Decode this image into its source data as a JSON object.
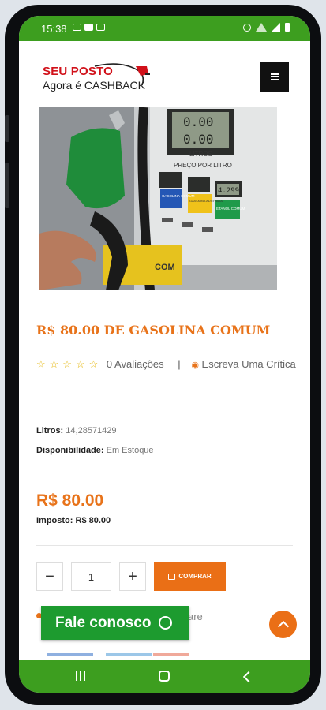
{
  "status_bar": {
    "time": "15:38"
  },
  "brand": {
    "line1": "SEU POSTO",
    "line2": "Agora é CASHBACK"
  },
  "product": {
    "title": "R$ 80.00 DE GASOLINA COMUM",
    "stars": "☆☆☆☆☆",
    "reviews_count": "0 Avaliações",
    "separator": "|",
    "write_review": "Escreva Uma Crítica",
    "liters_label": "Litros:",
    "liters_value": "14,28571429",
    "availability_label": "Disponibilidade:",
    "availability_value": "Em Estoque",
    "price": "R$ 80.00",
    "tax_label": "Imposto:",
    "tax_value": "R$ 80.00"
  },
  "pump_display": {
    "litros": "LITROS",
    "preco": "PREÇO POR LITRO",
    "rs": "R$",
    "gasolina_comum": "GASOLINA COMUM",
    "gasolina_aditivada": "GASOLINA ADITIVADA",
    "etanol_comum": "ETANOL COMUM",
    "screen": "0.00",
    "price_right": "4.299",
    "nozzle_label": "COM"
  },
  "cart": {
    "minus": "−",
    "plus": "+",
    "quantity": "1",
    "buy_label": "COMPRAR"
  },
  "share": {
    "text": "are"
  },
  "whatsapp": {
    "label": "Fale conosco"
  },
  "colors": {
    "brand_green": "#3d9e1f",
    "accent_orange": "#e8731a",
    "whatsapp_green": "#1d9b2f",
    "brand_red": "#d1111a"
  },
  "icons": {
    "menu": "hamburger-icon",
    "review": "chat-bubble-icon",
    "buy": "shopping-bag-icon",
    "whatsapp": "whatsapp-icon",
    "back_to_top": "chevron-up-icon"
  }
}
